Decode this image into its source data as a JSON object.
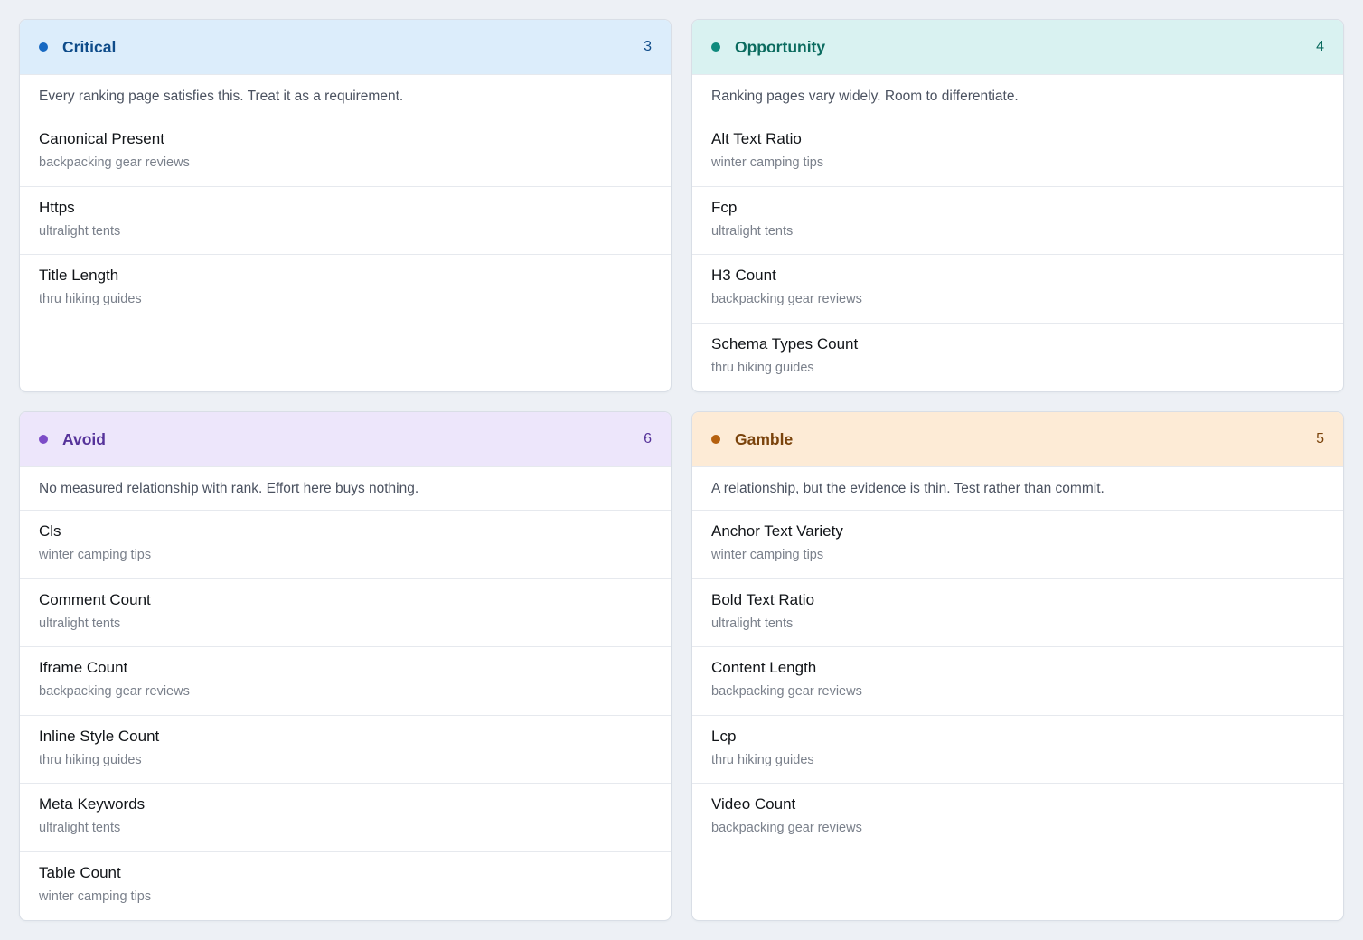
{
  "quadrants": [
    {
      "title": "Critical",
      "count": "3",
      "description": "Every ranking page satisfies this. Treat it as a requirement.",
      "header_bg": "#dcedfb",
      "accent": "#1769c2",
      "title_color": "#0f4c8a",
      "items": [
        {
          "name": "Canonical Present",
          "sub": "backpacking gear reviews"
        },
        {
          "name": "Https",
          "sub": "ultralight tents"
        },
        {
          "name": "Title Length",
          "sub": "thru hiking guides"
        }
      ]
    },
    {
      "title": "Opportunity",
      "count": "4",
      "description": "Ranking pages vary widely. Room to differentiate.",
      "header_bg": "#d9f2f1",
      "accent": "#0f8a7d",
      "title_color": "#0b6b5f",
      "items": [
        {
          "name": "Alt Text Ratio",
          "sub": "winter camping tips"
        },
        {
          "name": "Fcp",
          "sub": "ultralight tents"
        },
        {
          "name": "H3 Count",
          "sub": "backpacking gear reviews"
        },
        {
          "name": "Schema Types Count",
          "sub": "thru hiking guides"
        }
      ]
    },
    {
      "title": "Avoid",
      "count": "6",
      "description": "No measured relationship with rank. Effort here buys nothing.",
      "header_bg": "#ede6fb",
      "accent": "#7c4cc7",
      "title_color": "#56339a",
      "items": [
        {
          "name": "Cls",
          "sub": "winter camping tips"
        },
        {
          "name": "Comment Count",
          "sub": "ultralight tents"
        },
        {
          "name": "Iframe Count",
          "sub": "backpacking gear reviews"
        },
        {
          "name": "Inline Style Count",
          "sub": "thru hiking guides"
        },
        {
          "name": "Meta Keywords",
          "sub": "ultralight tents"
        },
        {
          "name": "Table Count",
          "sub": "winter camping tips"
        }
      ]
    },
    {
      "title": "Gamble",
      "count": "5",
      "description": "A relationship, but the evidence is thin. Test rather than commit.",
      "header_bg": "#fdebd6",
      "accent": "#b5600e",
      "title_color": "#7a430c",
      "items": [
        {
          "name": "Anchor Text Variety",
          "sub": "winter camping tips"
        },
        {
          "name": "Bold Text Ratio",
          "sub": "ultralight tents"
        },
        {
          "name": "Content Length",
          "sub": "backpacking gear reviews"
        },
        {
          "name": "Lcp",
          "sub": "thru hiking guides"
        },
        {
          "name": "Video Count",
          "sub": "backpacking gear reviews"
        }
      ]
    }
  ]
}
